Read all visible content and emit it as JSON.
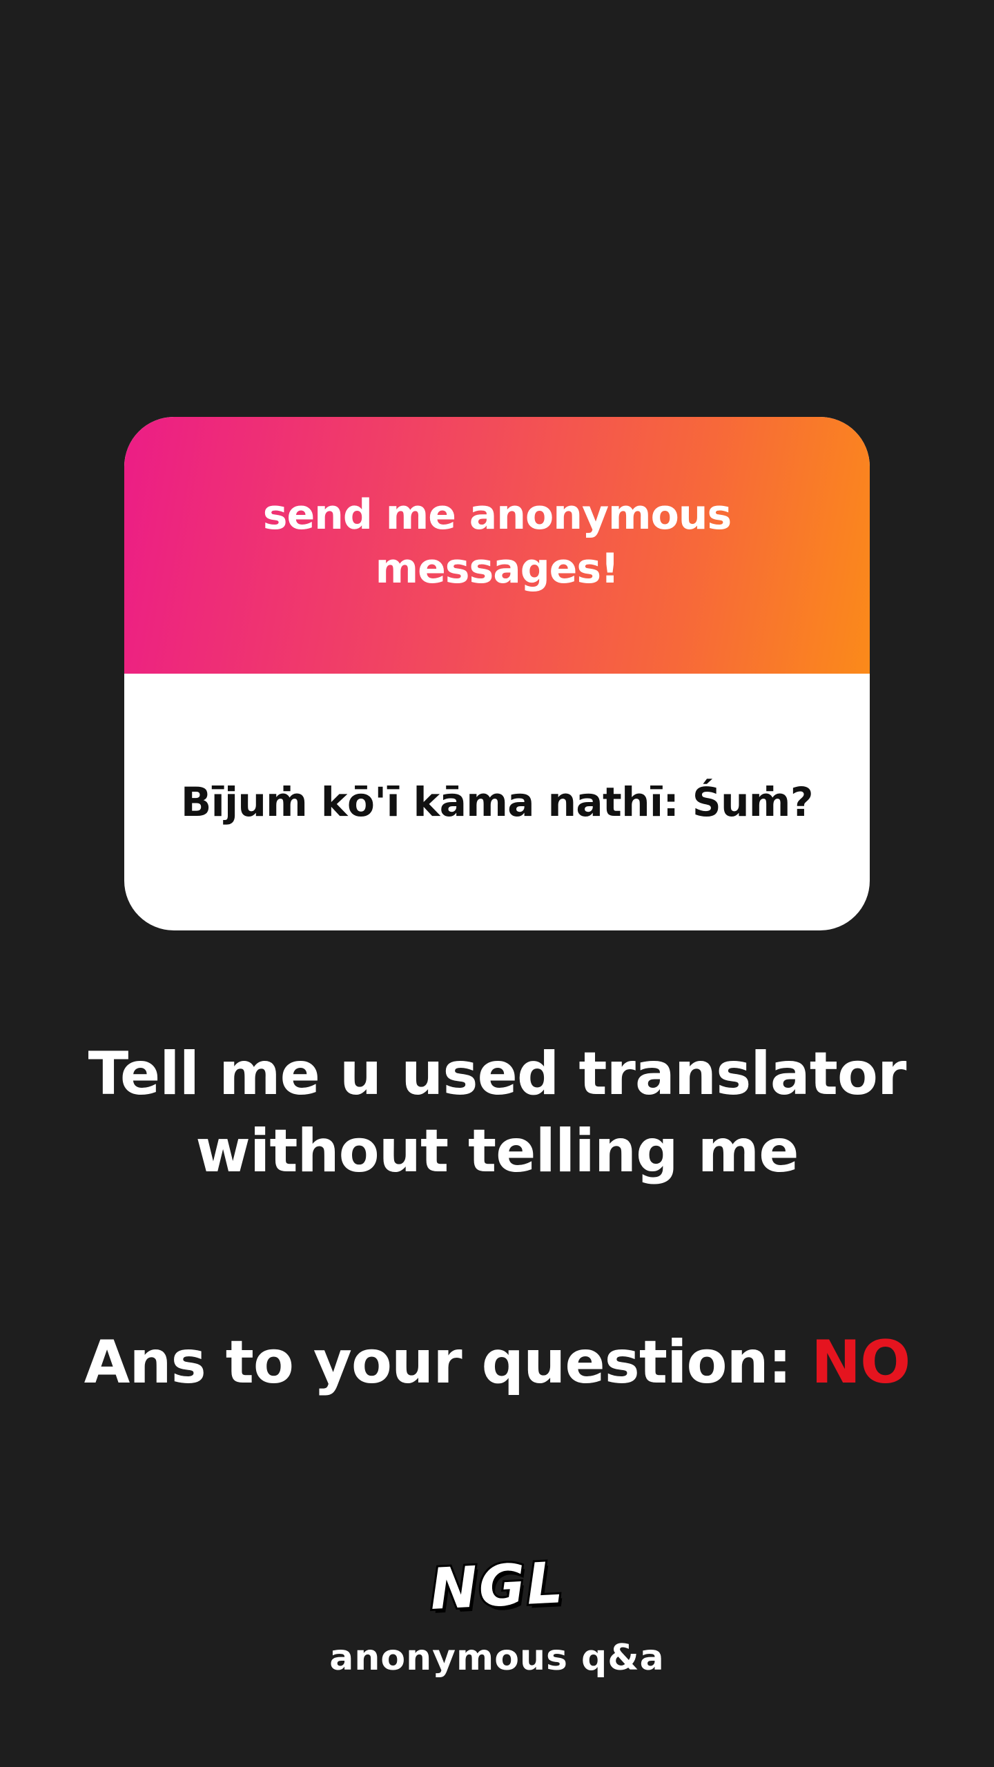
{
  "card": {
    "prompt": "send me anonymous messages!",
    "message": "Bījuṁ kō'ī kāma nathī: Śuṁ?"
  },
  "reply": {
    "line1": "Tell me u used translator",
    "line2": "without telling me"
  },
  "answer": {
    "prefix": "Ans to your question: ",
    "value": "NO",
    "value_color": "#e5141f"
  },
  "branding": {
    "logo": "NGL",
    "tagline": "anonymous q&a"
  },
  "colors": {
    "background": "#1e1e1e",
    "gradient_start": "#ec1d86",
    "gradient_end": "#fb8a1a"
  }
}
